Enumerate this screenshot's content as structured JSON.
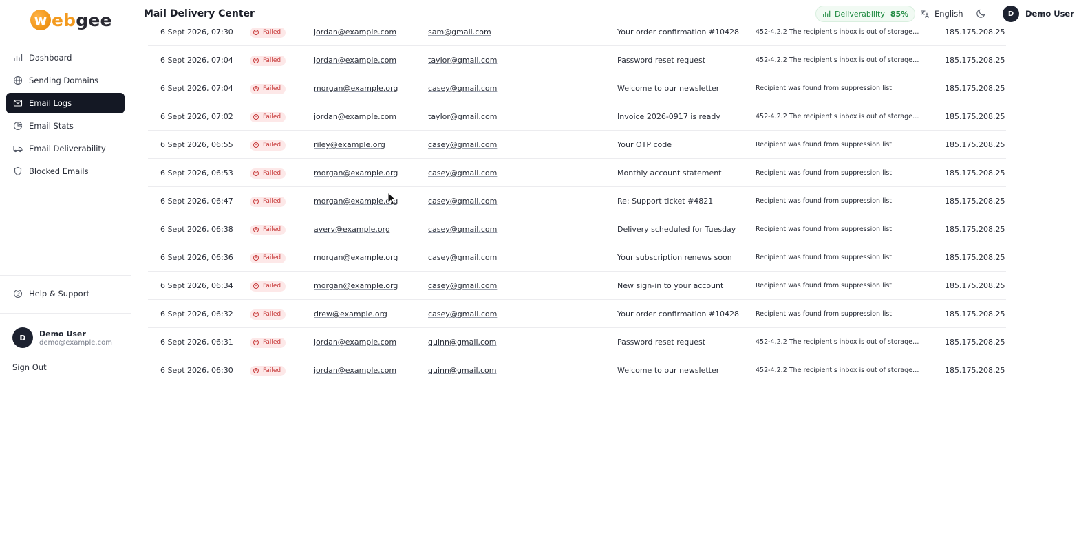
{
  "brand": {
    "logo_letter": "w",
    "logo_text_accent": "eb",
    "logo_text_rest": "gee"
  },
  "sidebar": {
    "items": [
      {
        "label": "Dashboard",
        "icon": "bar-chart-icon"
      },
      {
        "label": "Sending Domains",
        "icon": "globe-icon"
      },
      {
        "label": "Email Logs",
        "icon": "mail-icon",
        "active": true
      },
      {
        "label": "Email Stats",
        "icon": "pie-chart-icon"
      },
      {
        "label": "Email Deliverability",
        "icon": "truck-icon"
      },
      {
        "label": "Blocked Emails",
        "icon": "shield-icon"
      }
    ],
    "help_label": "Help & Support",
    "user": {
      "initial": "D",
      "name": "Demo User",
      "email": "demo@example.com"
    },
    "sign_out_label": "Sign Out"
  },
  "header": {
    "title": "Mail Delivery Center",
    "deliverability_label": "Deliverability",
    "deliverability_value": "85%",
    "language": "English",
    "user_initial": "D",
    "user_name": "Demo User"
  },
  "colors": {
    "accent": "#f39a1e",
    "active_nav": "#141824",
    "success": "#1f8a41",
    "failed": "#c73a3a"
  },
  "logs": [
    {
      "date": "6 Sept 2026, 07:30",
      "status": "Failed",
      "from": "jordan@example.com",
      "to": "sam@gmail.com",
      "subject": "Your order confirmation #10428",
      "reason": "452-4.2.2 The recipient's inbox is out of storage spac...",
      "ip": "185.175.208.25"
    },
    {
      "date": "6 Sept 2026, 07:04",
      "status": "Failed",
      "from": "jordan@example.com",
      "to": "taylor@gmail.com",
      "subject": "Password reset request",
      "reason": "452-4.2.2 The recipient's inbox is out of storage spac...",
      "ip": "185.175.208.25"
    },
    {
      "date": "6 Sept 2026, 07:04",
      "status": "Failed",
      "from": "morgan@example.org",
      "to": "casey@gmail.com",
      "subject": "Welcome to our newsletter",
      "reason": "Recipient was found from suppression list",
      "ip": "185.175.208.25"
    },
    {
      "date": "6 Sept 2026, 07:02",
      "status": "Failed",
      "from": "jordan@example.com",
      "to": "taylor@gmail.com",
      "subject": "Invoice 2026-0917 is ready",
      "reason": "452-4.2.2 The recipient's inbox is out of storage spac...",
      "ip": "185.175.208.25"
    },
    {
      "date": "6 Sept 2026, 06:55",
      "status": "Failed",
      "from": "riley@example.org",
      "to": "casey@gmail.com",
      "subject": "Your OTP code",
      "reason": "Recipient was found from suppression list",
      "ip": "185.175.208.25"
    },
    {
      "date": "6 Sept 2026, 06:53",
      "status": "Failed",
      "from": "morgan@example.org",
      "to": "casey@gmail.com",
      "subject": "Monthly account statement",
      "reason": "Recipient was found from suppression list",
      "ip": "185.175.208.25"
    },
    {
      "date": "6 Sept 2026, 06:47",
      "status": "Failed",
      "from": "morgan@example.org",
      "to": "casey@gmail.com",
      "subject": "Re: Support ticket #4821",
      "reason": "Recipient was found from suppression list",
      "ip": "185.175.208.25"
    },
    {
      "date": "6 Sept 2026, 06:38",
      "status": "Failed",
      "from": "avery@example.org",
      "to": "casey@gmail.com",
      "subject": "Delivery scheduled for Tuesday",
      "reason": "Recipient was found from suppression list",
      "ip": "185.175.208.25"
    },
    {
      "date": "6 Sept 2026, 06:36",
      "status": "Failed",
      "from": "morgan@example.org",
      "to": "casey@gmail.com",
      "subject": "Your subscription renews soon",
      "reason": "Recipient was found from suppression list",
      "ip": "185.175.208.25"
    },
    {
      "date": "6 Sept 2026, 06:34",
      "status": "Failed",
      "from": "morgan@example.org",
      "to": "casey@gmail.com",
      "subject": "New sign-in to your account",
      "reason": "Recipient was found from suppression list",
      "ip": "185.175.208.25"
    },
    {
      "date": "6 Sept 2026, 06:32",
      "status": "Failed",
      "from": "drew@example.org",
      "to": "casey@gmail.com",
      "subject": "Your order confirmation #10428",
      "reason": "Recipient was found from suppression list",
      "ip": "185.175.208.25"
    },
    {
      "date": "6 Sept 2026, 06:31",
      "status": "Failed",
      "from": "jordan@example.com",
      "to": "quinn@gmail.com",
      "subject": "Password reset request",
      "reason": "452-4.2.2 The recipient's inbox is out of storage spac...",
      "ip": "185.175.208.25"
    },
    {
      "date": "6 Sept 2026, 06:30",
      "status": "Failed",
      "from": "jordan@example.com",
      "to": "quinn@gmail.com",
      "subject": "Welcome to our newsletter",
      "reason": "452-4.2.2 The recipient's inbox is out of storage spac...",
      "ip": "185.175.208.25"
    }
  ]
}
